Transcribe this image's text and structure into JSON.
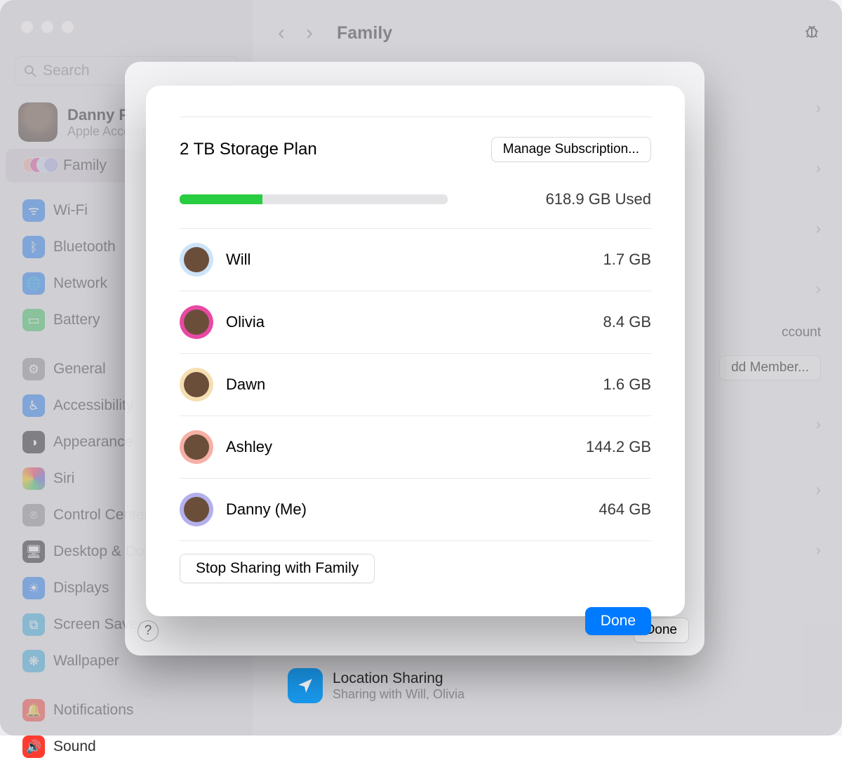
{
  "window": {
    "title": "Family"
  },
  "search": {
    "placeholder": "Search"
  },
  "account": {
    "name": "Danny F",
    "sub": "Apple Account"
  },
  "sidebar": {
    "family": "Family",
    "items": [
      "Wi-Fi",
      "Bluetooth",
      "Network",
      "Battery",
      "General",
      "Accessibility",
      "Appearance",
      "Siri",
      "Control Center",
      "Desktop & Dock",
      "Displays",
      "Screen Saver",
      "Wallpaper",
      "Notifications",
      "Sound"
    ]
  },
  "content": {
    "account_hint": "ccount",
    "add_member": "dd Member...",
    "location_sharing_title": "Location Sharing",
    "location_sharing_sub": "Sharing with Will, Olivia"
  },
  "outer": {
    "help": "?",
    "done_label": "Done"
  },
  "modal": {
    "title": "2 TB Storage Plan",
    "manage_label": "Manage Subscription...",
    "progress_percent": 31,
    "used_label": "618.9 GB Used",
    "members": [
      {
        "name": "Will",
        "size": "1.7 GB",
        "bg": "#cde4f8"
      },
      {
        "name": "Olivia",
        "size": "8.4 GB",
        "bg": "#e84aa3"
      },
      {
        "name": "Dawn",
        "size": "1.6 GB",
        "bg": "#f5dfb2"
      },
      {
        "name": "Ashley",
        "size": "144.2 GB",
        "bg": "#f7b0a6"
      },
      {
        "name": "Danny (Me)",
        "size": "464 GB",
        "bg": "#b3b0ec"
      }
    ],
    "stop_label": "Stop Sharing with Family",
    "done_label": "Done"
  }
}
